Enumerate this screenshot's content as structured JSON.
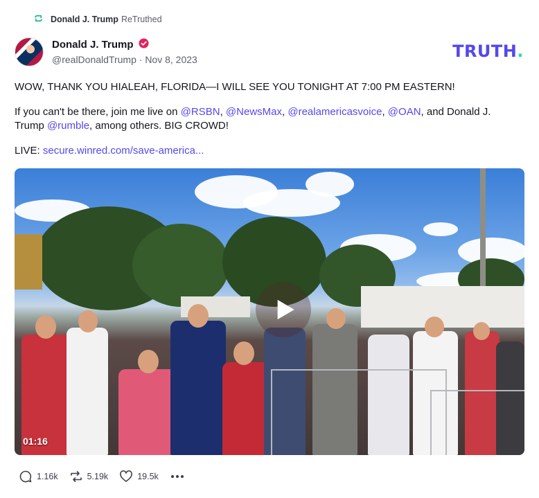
{
  "retruth": {
    "icon": "retruth-icon",
    "user": "Donald J. Trump",
    "label": "ReTruthed"
  },
  "post": {
    "author": {
      "display_name": "Donald J. Trump",
      "verified_icon": "verified-badge-icon",
      "handle": "@realDonaldTrump",
      "separator": "·",
      "date": "Nov 8, 2023"
    },
    "logo": {
      "text": "TRUTH",
      "dot": ".",
      "color": "#5448ee",
      "dot_color": "#17e3b5"
    },
    "line1": "WOW, THANK YOU HIALEAH, FLORIDA—I WILL SEE YOU TONIGHT AT 7:00 PM EASTERN!",
    "line2": {
      "t1": "If you can't be there, join me live on ",
      "m1": "@RSBN",
      "t2": ", ",
      "m2": "@NewsMax",
      "t3": ", ",
      "m3": "@realamericasvoice",
      "t4": ", ",
      "m4": "@OAN",
      "t5": ", and Donald J. Trump ",
      "m5": "@rumble",
      "t6": ", among others. BIG CROWD!"
    },
    "line3": {
      "prefix": "LIVE: ",
      "link": "secure.winred.com/save-america..."
    },
    "video": {
      "duration": "01:16",
      "play_icon": "play-icon"
    },
    "actions": {
      "replies": "1.16k",
      "retruths": "5.19k",
      "likes": "19.5k",
      "more_icon": "more-dots-icon"
    },
    "accent_color": "#5448ee"
  }
}
